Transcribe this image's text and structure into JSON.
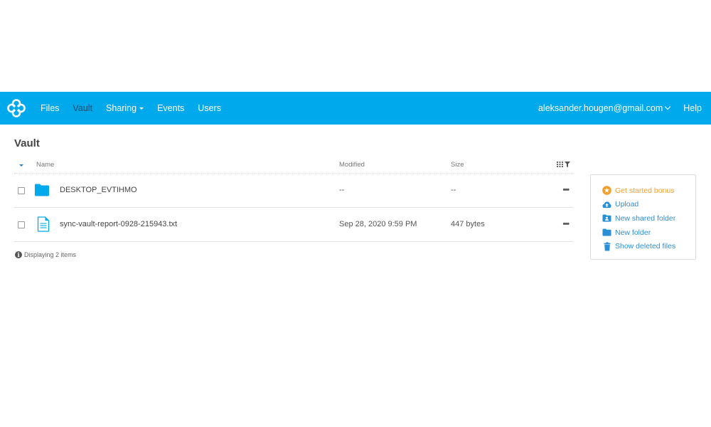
{
  "navbar": {
    "background_color": "#00a9ec",
    "logo_icon": "sync-logo-icon",
    "items": [
      {
        "label": "Files",
        "active": false
      },
      {
        "label": "Vault",
        "active": true
      },
      {
        "label": "Sharing",
        "active": false,
        "has_dropdown": true
      },
      {
        "label": "Events",
        "active": false
      },
      {
        "label": "Users",
        "active": false
      }
    ],
    "user_email": "aleksander.hougen@gmail.com",
    "help_label": "Help"
  },
  "page": {
    "title": "Vault"
  },
  "table": {
    "columns": {
      "name": "Name",
      "modified": "Modified",
      "size": "Size"
    },
    "column_tools": [
      "columns-grid-icon",
      "filter-icon"
    ],
    "rows": [
      {
        "type": "folder",
        "icon": "folder-icon",
        "name": "DESKTOP_EVTIHMO",
        "modified": "--",
        "size": "--"
      },
      {
        "type": "file",
        "icon": "text-file-icon",
        "name": "sync-vault-report-0928-215943.txt",
        "modified": "Sep 28, 2020 9:59 PM",
        "size": "447 bytes"
      }
    ],
    "more_label": "•••",
    "footer": "Displaying 2 items"
  },
  "actions": [
    {
      "label": "Get started bonus",
      "icon": "star-badge-icon",
      "color": "#f0a030"
    },
    {
      "label": "Upload",
      "icon": "cloud-upload-icon",
      "color": "#2a8fd4"
    },
    {
      "label": "New shared folder",
      "icon": "shared-folder-icon",
      "color": "#2a8fd4"
    },
    {
      "label": "New folder",
      "icon": "folder-icon",
      "color": "#2a8fd4"
    },
    {
      "label": "Show deleted files",
      "icon": "trash-icon",
      "color": "#2a8fd4"
    }
  ]
}
